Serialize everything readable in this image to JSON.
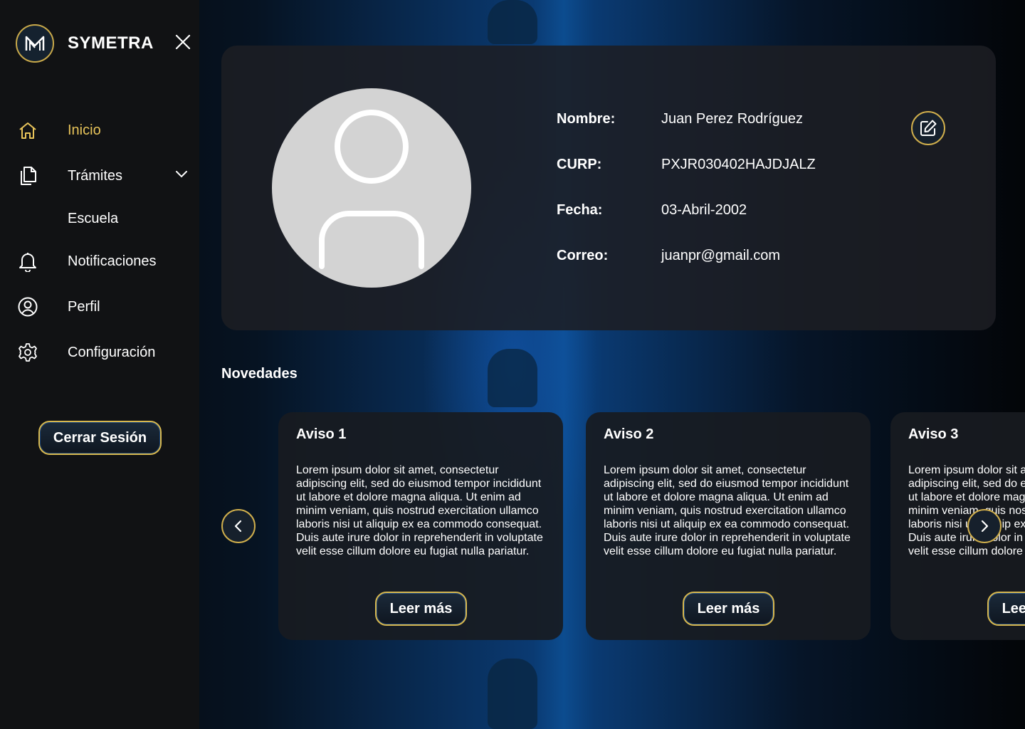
{
  "sidebar": {
    "brand": "SYMETRA",
    "items": [
      {
        "label": "Inicio"
      },
      {
        "label": "Trámites"
      },
      {
        "label": "Escuela"
      },
      {
        "label": "Notificaciones"
      },
      {
        "label": "Perfil"
      },
      {
        "label": "Configuración"
      }
    ],
    "logout_label": "Cerrar Sesión"
  },
  "profile": {
    "fields": [
      {
        "label": "Nombre:",
        "value": "Juan Perez Rodríguez"
      },
      {
        "label": "CURP:",
        "value": "PXJR030402HAJDJALZ"
      },
      {
        "label": "Fecha:",
        "value": "03-Abril-2002"
      },
      {
        "label": "Correo:",
        "value": "juanpr@gmail.com"
      }
    ]
  },
  "news": {
    "title": "Novedades",
    "cards": [
      {
        "title": "Aviso 1",
        "body": "Lorem ipsum dolor sit amet, consectetur adipiscing elit, sed do eiusmod  tempor incididunt ut labore et dolore magna aliqua. Ut enim ad minim  veniam, quis nostrud exercitation ullamco laboris nisi ut aliquip ex ea  commodo consequat. Duis aute irure dolor in reprehenderit in voluptate  velit esse cillum dolore eu fugiat nulla pariatur.",
        "button": "Leer más"
      },
      {
        "title": "Aviso 2",
        "body": "Lorem ipsum dolor sit amet, consectetur adipiscing elit, sed do eiusmod  tempor incididunt ut labore et dolore magna aliqua. Ut enim ad minim  veniam, quis nostrud exercitation ullamco laboris nisi ut aliquip ex ea  commodo consequat. Duis aute irure dolor in reprehenderit in voluptate  velit esse cillum dolore eu fugiat nulla pariatur.",
        "button": "Leer más"
      },
      {
        "title": "Aviso 3",
        "body": "Lorem ipsum dolor sit amet, consectetur adipiscing elit, sed do eiusmod  tempor incididunt ut labore et dolore magna aliqua. Ut enim ad minim  veniam, quis nostrud exercitation ullamco laboris nisi ut aliquip ex ea  commodo consequat. Duis aute irure dolor in reprehenderit in voluptate  velit esse cillum dolore eu fugiat nulla pariatur.",
        "button": "Leer más"
      }
    ]
  },
  "colors": {
    "accent": "#e8c45a",
    "sidebar_bg": "#111214",
    "card_bg": "#1c1e23",
    "avatar_bg": "#d3d3d3"
  },
  "icons": [
    "logo-icon",
    "close-icon",
    "home-icon",
    "documents-icon",
    "chevron-down-icon",
    "bell-icon",
    "user-circle-icon",
    "gear-icon",
    "edit-icon",
    "chevron-left-icon",
    "chevron-right-icon"
  ]
}
